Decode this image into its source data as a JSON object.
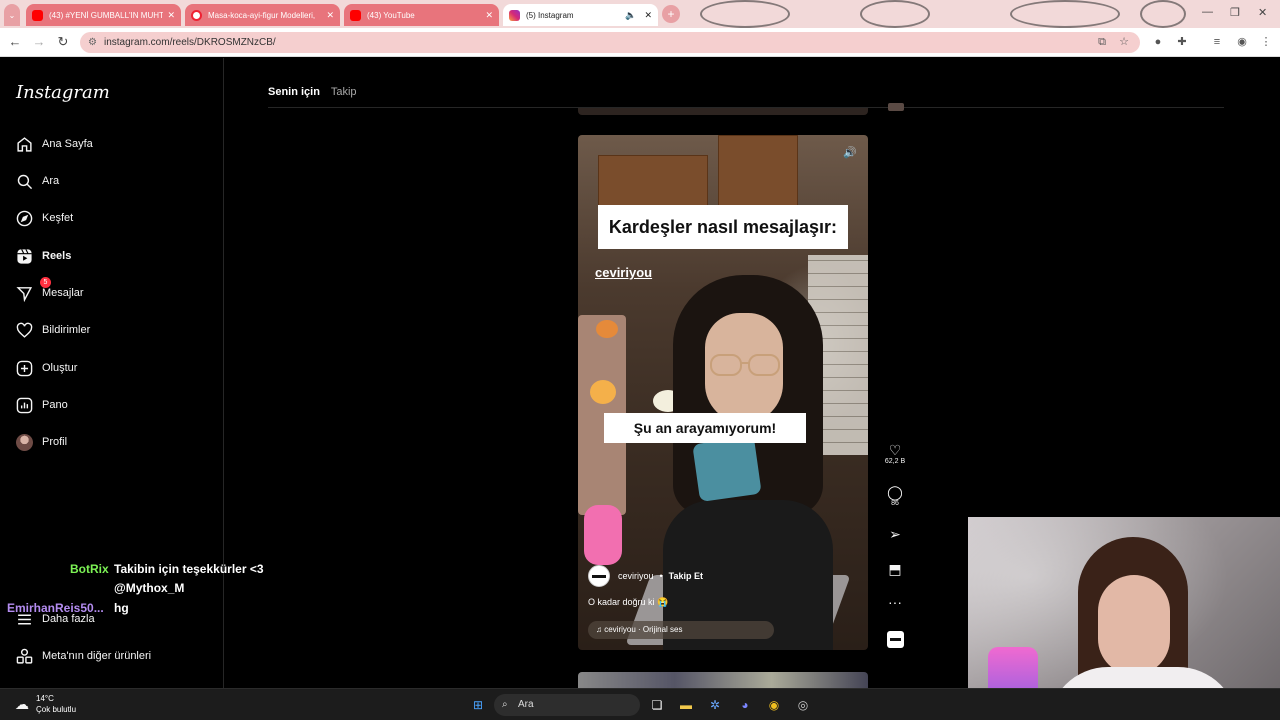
{
  "browser": {
    "tabs": [
      {
        "title": "(43) #YENİ GUMBALL'IN MUHT",
        "color": "#e8747c",
        "favicon": "youtube-icon"
      },
      {
        "title": "Masa-koca-ayi-figur Modelleri,",
        "color": "#e8747c",
        "favicon": "site-icon"
      },
      {
        "title": "(43) YouTube",
        "color": "#e8747c",
        "favicon": "youtube-icon"
      },
      {
        "title": "(5) Instagram",
        "color": "#ffffff",
        "favicon": "instagram-icon"
      }
    ],
    "url": "instagram.com/reels/DKROSMZNzCB/"
  },
  "sidebar": {
    "logo": "Instagram",
    "items": [
      {
        "label": "Ana Sayfa",
        "icon": "home-icon"
      },
      {
        "label": "Ara",
        "icon": "search-icon"
      },
      {
        "label": "Keşfet",
        "icon": "compass-icon"
      },
      {
        "label": "Reels",
        "icon": "reels-icon"
      },
      {
        "label": "Mesajlar",
        "icon": "messenger-icon",
        "badge": "5"
      },
      {
        "label": "Bildirimler",
        "icon": "heart-icon"
      },
      {
        "label": "Oluştur",
        "icon": "plus-square-icon"
      },
      {
        "label": "Pano",
        "icon": "dashboard-icon"
      },
      {
        "label": "Profil",
        "icon": "avatar-icon"
      }
    ],
    "more": "Daha fazla",
    "meta": "Meta'nın diğer ürünleri"
  },
  "feed_tabs": {
    "for_you": "Senin için",
    "following": "Takip"
  },
  "reel": {
    "caption_top": "Kardeşler nasıl mesajlaşır:",
    "watermark": "ceviriyou",
    "caption_mid": "Şu an arayamıyorum!",
    "username": "ceviriyou",
    "separator": "•",
    "follow": "Takip Et",
    "description": "O kadar doğru ki 😭",
    "audio": "ceviriyou · Orijinal ses",
    "likes": "62,2 B",
    "comments": "86"
  },
  "stream_chat": [
    {
      "user": "BotRix",
      "user_color": "#7cf255",
      "message": "Takibin için teşekkürler <3"
    },
    {
      "user": "",
      "user_color": "#ffffff",
      "message": "@Mythox_M"
    },
    {
      "user": "EmirhanReis50...",
      "user_color": "#b48cf0",
      "message": "hg"
    }
  ],
  "taskbar": {
    "weather_temp": "14°C",
    "weather_desc": "Çok bulutlu",
    "search": "Ara"
  }
}
